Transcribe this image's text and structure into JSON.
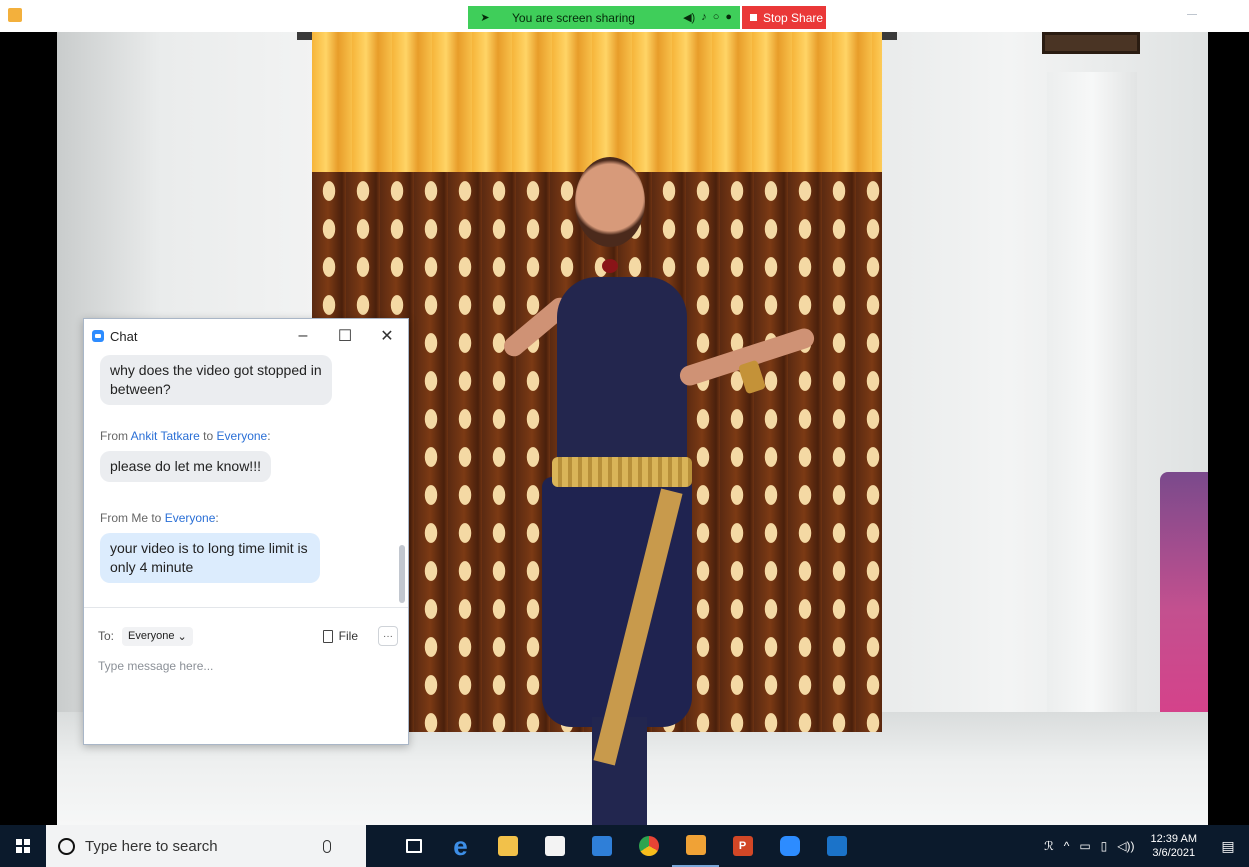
{
  "share_bar": {
    "status": "You are screen sharing",
    "stop_label": "Stop Share"
  },
  "chat": {
    "title": "Chat",
    "messages": [
      {
        "text_line1": "why does the video got stopped in",
        "text_line2": "between?"
      },
      {
        "from_prefix": "From ",
        "sender": "Ankit Tatkare",
        "to_word": " to ",
        "recipient": "Everyone",
        "suffix": ":",
        "text": "please do let me know!!!"
      },
      {
        "from_prefix": "From Me to ",
        "recipient": "Everyone",
        "suffix": ":",
        "text_line1": "your video is to long time limit is",
        "text_line2": "only 4 minute"
      }
    ],
    "to_label": "To:",
    "to_value": "Everyone",
    "file_label": "File",
    "more_label": "···",
    "input_placeholder": "Type message here..."
  },
  "taskbar": {
    "search_placeholder": "Type here to search",
    "time": "12:39 AM",
    "date": "3/6/2021"
  },
  "colors": {
    "share_green": "#3fce5a",
    "stop_red": "#ea3838",
    "zoom_blue": "#2d8cff",
    "taskbar": "#0b1a2c"
  }
}
